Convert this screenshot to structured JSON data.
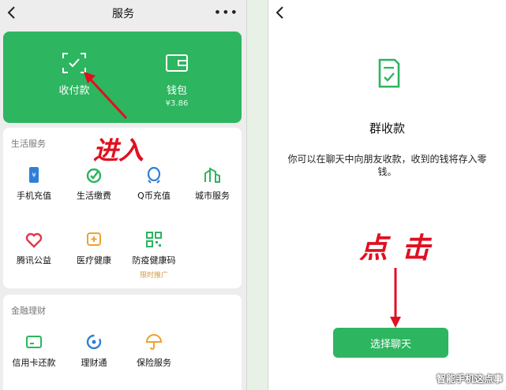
{
  "left": {
    "title": "服务",
    "more": "•••",
    "top_card": {
      "pay": {
        "label": "收付款"
      },
      "wallet": {
        "label": "钱包",
        "balance": "¥3.86"
      }
    },
    "life_section": {
      "title": "生活服务",
      "items": [
        {
          "label": "手机充值"
        },
        {
          "label": "生活缴费"
        },
        {
          "label": "Q币充值"
        },
        {
          "label": "城市服务"
        },
        {
          "label": "腾讯公益"
        },
        {
          "label": "医疗健康"
        },
        {
          "label": "防疫健康码",
          "promo": "限时推广"
        }
      ]
    },
    "finance_section": {
      "title": "金融理财",
      "items": [
        {
          "label": "信用卡还款"
        },
        {
          "label": "理财通"
        },
        {
          "label": "保险服务"
        }
      ]
    },
    "annotation": "进入"
  },
  "right": {
    "title": "群收款",
    "description": "你可以在聊天中向朋友收款，收到的钱将存入零钱。",
    "button": "选择聊天",
    "annotation": "点击"
  },
  "watermark": "智能手机这点事",
  "colors": {
    "brand_green": "#2db560",
    "annotation_red": "#e01020",
    "background": "#ededed"
  }
}
